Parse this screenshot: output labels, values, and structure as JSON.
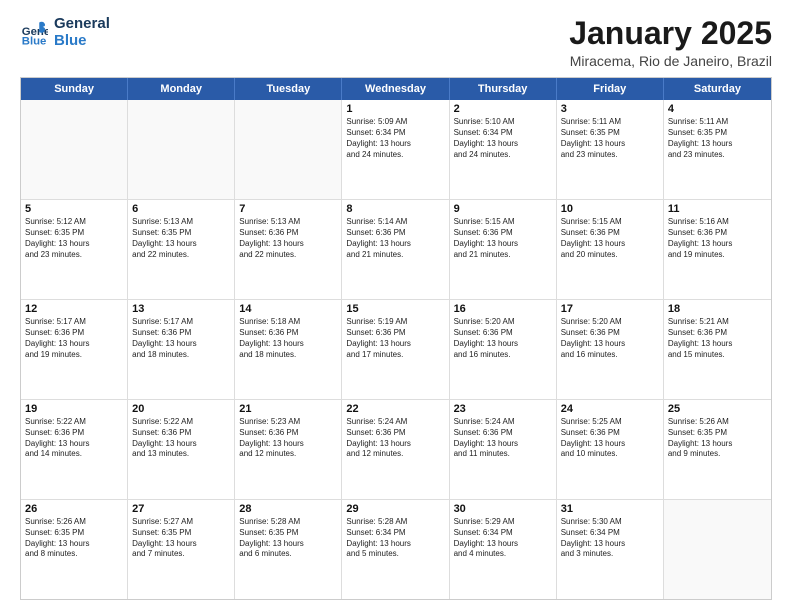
{
  "header": {
    "logo_line1": "General",
    "logo_line2": "Blue",
    "month": "January 2025",
    "location": "Miracema, Rio de Janeiro, Brazil"
  },
  "days_of_week": [
    "Sunday",
    "Monday",
    "Tuesday",
    "Wednesday",
    "Thursday",
    "Friday",
    "Saturday"
  ],
  "weeks": [
    [
      {
        "day": "",
        "info": ""
      },
      {
        "day": "",
        "info": ""
      },
      {
        "day": "",
        "info": ""
      },
      {
        "day": "1",
        "info": "Sunrise: 5:09 AM\nSunset: 6:34 PM\nDaylight: 13 hours\nand 24 minutes."
      },
      {
        "day": "2",
        "info": "Sunrise: 5:10 AM\nSunset: 6:34 PM\nDaylight: 13 hours\nand 24 minutes."
      },
      {
        "day": "3",
        "info": "Sunrise: 5:11 AM\nSunset: 6:35 PM\nDaylight: 13 hours\nand 23 minutes."
      },
      {
        "day": "4",
        "info": "Sunrise: 5:11 AM\nSunset: 6:35 PM\nDaylight: 13 hours\nand 23 minutes."
      }
    ],
    [
      {
        "day": "5",
        "info": "Sunrise: 5:12 AM\nSunset: 6:35 PM\nDaylight: 13 hours\nand 23 minutes."
      },
      {
        "day": "6",
        "info": "Sunrise: 5:13 AM\nSunset: 6:35 PM\nDaylight: 13 hours\nand 22 minutes."
      },
      {
        "day": "7",
        "info": "Sunrise: 5:13 AM\nSunset: 6:36 PM\nDaylight: 13 hours\nand 22 minutes."
      },
      {
        "day": "8",
        "info": "Sunrise: 5:14 AM\nSunset: 6:36 PM\nDaylight: 13 hours\nand 21 minutes."
      },
      {
        "day": "9",
        "info": "Sunrise: 5:15 AM\nSunset: 6:36 PM\nDaylight: 13 hours\nand 21 minutes."
      },
      {
        "day": "10",
        "info": "Sunrise: 5:15 AM\nSunset: 6:36 PM\nDaylight: 13 hours\nand 20 minutes."
      },
      {
        "day": "11",
        "info": "Sunrise: 5:16 AM\nSunset: 6:36 PM\nDaylight: 13 hours\nand 19 minutes."
      }
    ],
    [
      {
        "day": "12",
        "info": "Sunrise: 5:17 AM\nSunset: 6:36 PM\nDaylight: 13 hours\nand 19 minutes."
      },
      {
        "day": "13",
        "info": "Sunrise: 5:17 AM\nSunset: 6:36 PM\nDaylight: 13 hours\nand 18 minutes."
      },
      {
        "day": "14",
        "info": "Sunrise: 5:18 AM\nSunset: 6:36 PM\nDaylight: 13 hours\nand 18 minutes."
      },
      {
        "day": "15",
        "info": "Sunrise: 5:19 AM\nSunset: 6:36 PM\nDaylight: 13 hours\nand 17 minutes."
      },
      {
        "day": "16",
        "info": "Sunrise: 5:20 AM\nSunset: 6:36 PM\nDaylight: 13 hours\nand 16 minutes."
      },
      {
        "day": "17",
        "info": "Sunrise: 5:20 AM\nSunset: 6:36 PM\nDaylight: 13 hours\nand 16 minutes."
      },
      {
        "day": "18",
        "info": "Sunrise: 5:21 AM\nSunset: 6:36 PM\nDaylight: 13 hours\nand 15 minutes."
      }
    ],
    [
      {
        "day": "19",
        "info": "Sunrise: 5:22 AM\nSunset: 6:36 PM\nDaylight: 13 hours\nand 14 minutes."
      },
      {
        "day": "20",
        "info": "Sunrise: 5:22 AM\nSunset: 6:36 PM\nDaylight: 13 hours\nand 13 minutes."
      },
      {
        "day": "21",
        "info": "Sunrise: 5:23 AM\nSunset: 6:36 PM\nDaylight: 13 hours\nand 12 minutes."
      },
      {
        "day": "22",
        "info": "Sunrise: 5:24 AM\nSunset: 6:36 PM\nDaylight: 13 hours\nand 12 minutes."
      },
      {
        "day": "23",
        "info": "Sunrise: 5:24 AM\nSunset: 6:36 PM\nDaylight: 13 hours\nand 11 minutes."
      },
      {
        "day": "24",
        "info": "Sunrise: 5:25 AM\nSunset: 6:36 PM\nDaylight: 13 hours\nand 10 minutes."
      },
      {
        "day": "25",
        "info": "Sunrise: 5:26 AM\nSunset: 6:35 PM\nDaylight: 13 hours\nand 9 minutes."
      }
    ],
    [
      {
        "day": "26",
        "info": "Sunrise: 5:26 AM\nSunset: 6:35 PM\nDaylight: 13 hours\nand 8 minutes."
      },
      {
        "day": "27",
        "info": "Sunrise: 5:27 AM\nSunset: 6:35 PM\nDaylight: 13 hours\nand 7 minutes."
      },
      {
        "day": "28",
        "info": "Sunrise: 5:28 AM\nSunset: 6:35 PM\nDaylight: 13 hours\nand 6 minutes."
      },
      {
        "day": "29",
        "info": "Sunrise: 5:28 AM\nSunset: 6:34 PM\nDaylight: 13 hours\nand 5 minutes."
      },
      {
        "day": "30",
        "info": "Sunrise: 5:29 AM\nSunset: 6:34 PM\nDaylight: 13 hours\nand 4 minutes."
      },
      {
        "day": "31",
        "info": "Sunrise: 5:30 AM\nSunset: 6:34 PM\nDaylight: 13 hours\nand 3 minutes."
      },
      {
        "day": "",
        "info": ""
      }
    ]
  ]
}
